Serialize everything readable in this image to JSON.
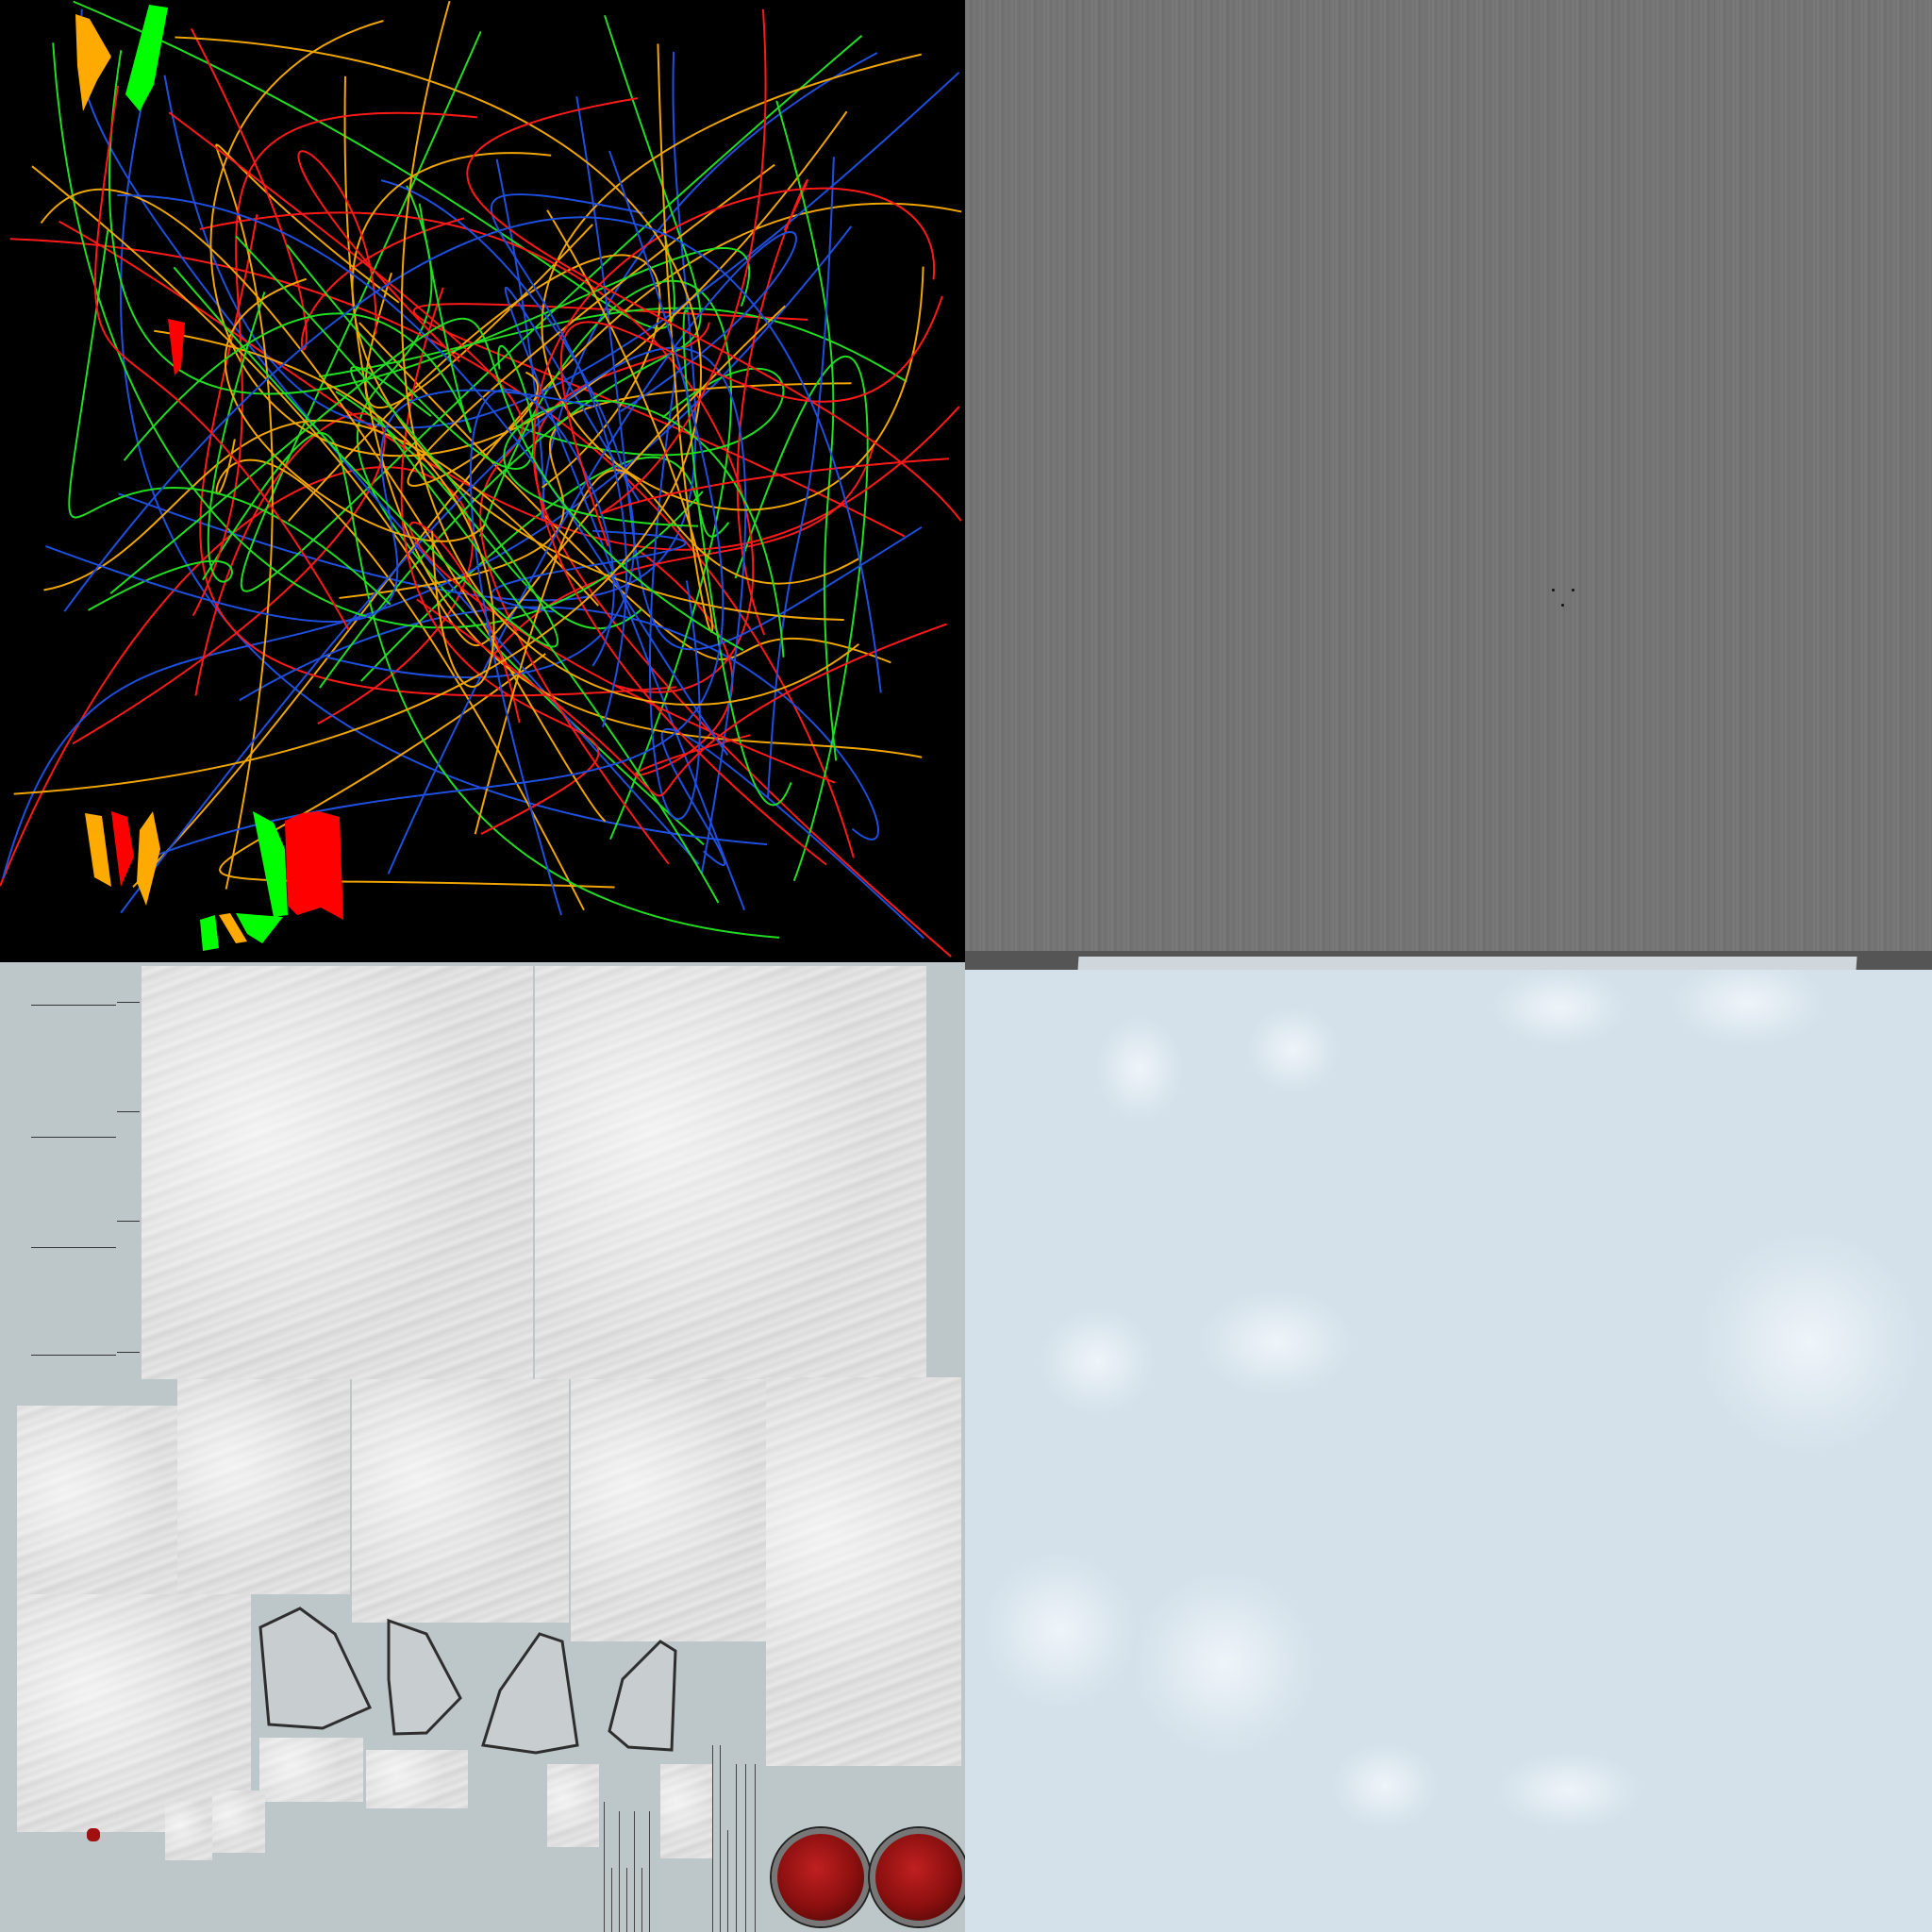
{
  "texture_atlas": {
    "quadrants": [
      {
        "name": "wire-lines-mask",
        "background": "#000000"
      },
      {
        "name": "brushed-metal",
        "background": "#747474"
      },
      {
        "name": "snow-rock-uv-islands",
        "background": "#bdc6c9"
      },
      {
        "name": "snow-surface",
        "background": "#d4e1ea"
      }
    ],
    "line_colors": [
      "#ff1a1a",
      "#22dd22",
      "#1f4fdf",
      "#f0a500"
    ],
    "marker_colors": {
      "orange": "#ffaa00",
      "green": "#00ff00",
      "red": "#ff0000"
    },
    "gauge_color": "#9a1111"
  }
}
